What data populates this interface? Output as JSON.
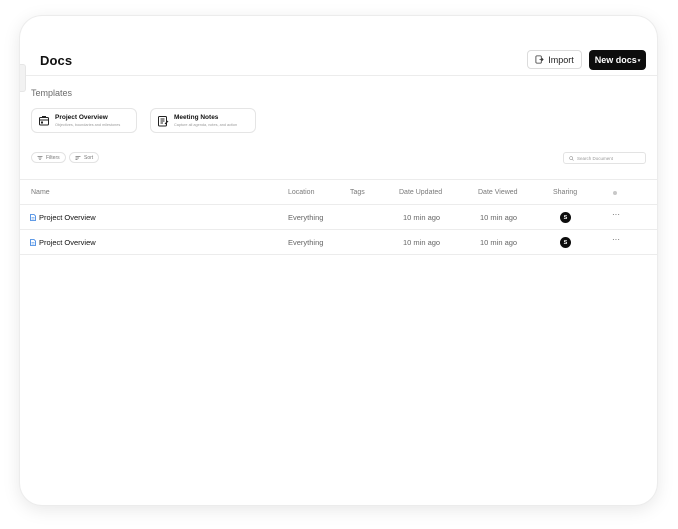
{
  "header": {
    "title": "Docs",
    "import_label": "Import",
    "new_docs_label": "New docs",
    "new_docs_chevron": "▾"
  },
  "templates": {
    "label": "Templates",
    "items": [
      {
        "name": "Project Overview",
        "description": "Objectives, boundaries and milestones",
        "icon": "project-overview-icon"
      },
      {
        "name": "Meeting Notes",
        "description": "Capture all agenda, notes, and action",
        "icon": "meeting-notes-icon"
      }
    ]
  },
  "toolbar": {
    "filters_label": "Filters",
    "sort_label": "Sort",
    "search_placeholder": "Search Document"
  },
  "table": {
    "columns": [
      "Name",
      "Location",
      "Tags",
      "Date Updated",
      "Date Viewed",
      "Sharing"
    ],
    "rows": [
      {
        "name": "Project Overview",
        "location": "Everything",
        "tags": "",
        "date_updated": "10 min ago",
        "date_viewed": "10 min ago",
        "sharing_initial": "S",
        "more": "···"
      },
      {
        "name": "Project Overview",
        "location": "Everything",
        "tags": "",
        "date_updated": "10 min ago",
        "date_viewed": "10 min ago",
        "sharing_initial": "S",
        "more": "···"
      }
    ]
  },
  "colors": {
    "accent_dark": "#0d0d0d",
    "doc_icon_blue": "#2f7ce0",
    "border": "#e5e5e5"
  }
}
